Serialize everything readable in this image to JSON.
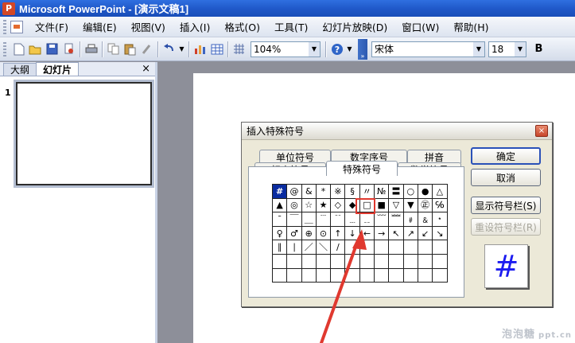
{
  "window": {
    "title": "Microsoft PowerPoint - [演示文稿1]"
  },
  "menubar": {
    "items": [
      "文件(F)",
      "编辑(E)",
      "视图(V)",
      "插入(I)",
      "格式(O)",
      "工具(T)",
      "幻灯片放映(D)",
      "窗口(W)",
      "帮助(H)"
    ]
  },
  "toolbar": {
    "zoom": "104%",
    "font": "宋体",
    "size": "18",
    "bold": "B"
  },
  "panel": {
    "tabs": [
      "大纲",
      "幻灯片"
    ],
    "close": "×",
    "slide_number": "1"
  },
  "dialog": {
    "title": "插入特殊符号",
    "close": "×",
    "tabs_back": [
      "单位符号",
      "数字序号",
      "拼音"
    ],
    "tabs_front": [
      "标点符号",
      "特殊符号",
      "数学符号"
    ],
    "active_tab": "特殊符号",
    "symbols": [
      [
        "#",
        "@",
        "&",
        "*",
        "※",
        "§",
        "〃",
        "№",
        "〓",
        "○",
        "●",
        "△"
      ],
      [
        "▲",
        "◎",
        "☆",
        "★",
        "◇",
        "◆",
        "□",
        "■",
        "▽",
        "▼",
        "㊣",
        "℅"
      ],
      [
        "ˉ",
        "￣",
        "＿",
        "﹉",
        "﹊",
        "﹍",
        "﹎",
        "﹋",
        "﹌",
        "﹟",
        "﹠",
        "﹡"
      ],
      [
        "♀",
        "♂",
        "⊕",
        "⊙",
        "↑",
        "↓",
        "←",
        "→",
        "↖",
        "↗",
        "↙",
        "↘"
      ],
      [
        "∥",
        "∣",
        "／",
        "＼",
        "∕",
        "",
        "",
        "",
        "",
        "",
        "",
        ""
      ],
      [
        "",
        "",
        "",
        "",
        "",
        "",
        "",
        "",
        "",
        "",
        "",
        ""
      ],
      [
        "",
        "",
        "",
        "",
        "",
        "",
        "",
        "",
        "",
        "",
        "",
        ""
      ]
    ],
    "buttons": {
      "ok": "确定",
      "cancel": "取消",
      "show_bar": "显示符号栏(S)",
      "reset_bar": "重设符号栏(R)"
    },
    "preview": "#"
  },
  "watermark": {
    "text": "泡泡糖",
    "site": "ppt.cn"
  },
  "colors": {
    "titlebar": "#1f57c8",
    "selected_cell": "#0a2ca0",
    "highlight": "#e0392f",
    "preview_glyph": "#1c1cf0"
  }
}
